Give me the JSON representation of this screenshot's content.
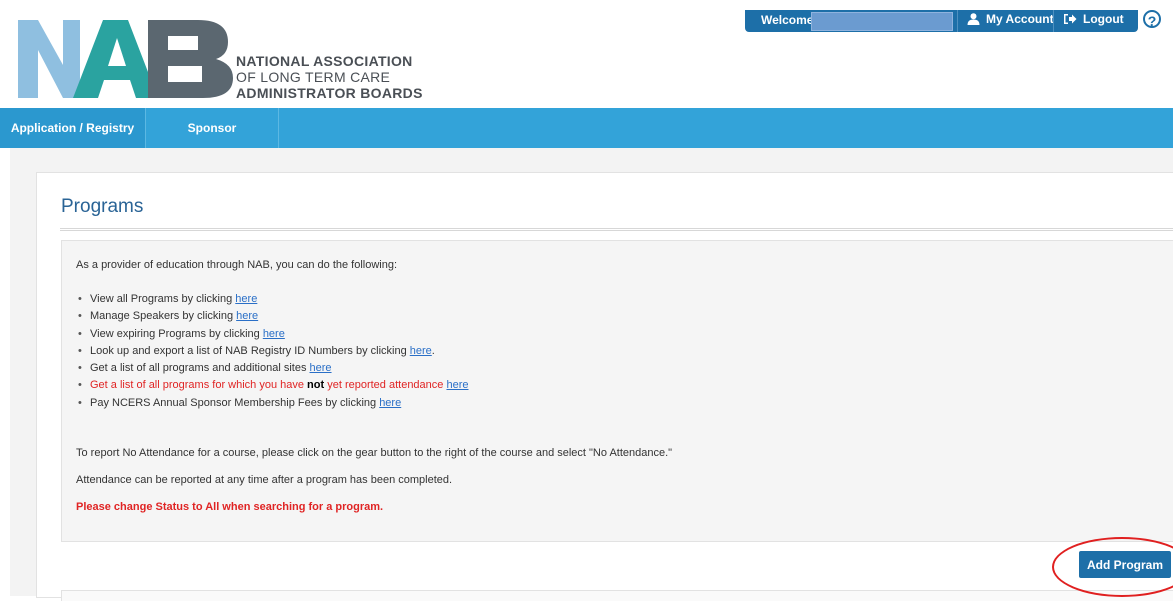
{
  "header": {
    "org_line1": "NATIONAL ASSOCIATION",
    "org_line2": "OF LONG TERM CARE",
    "org_line3": "ADMINISTRATOR BOARDS",
    "logo_letters": "NAB",
    "welcome_label": "Welcome",
    "account_label": "My Account",
    "logout_label": "Logout",
    "help_label": "?"
  },
  "nav": {
    "items": [
      {
        "label": "Application / Registry"
      },
      {
        "label": "Sponsor"
      }
    ]
  },
  "main": {
    "title": "Programs",
    "intro": "As a provider of education through NAB, you can do the following:",
    "actions": [
      {
        "text": "View all Programs by clicking ",
        "link": "here",
        "after": ""
      },
      {
        "text": "Manage Speakers by clicking ",
        "link": "here",
        "after": ""
      },
      {
        "text": "View expiring Programs by clicking ",
        "link": "here",
        "after": ""
      },
      {
        "text": "Look up and export a list of NAB Registry ID Numbers by clicking ",
        "link": "here",
        "after": "."
      },
      {
        "text": "Get a list of all programs and additional sites ",
        "link": "here",
        "after": ""
      },
      {
        "text_before": "Get a list of all programs for which you have ",
        "bold": "not",
        "text": " yet reported attendance ",
        "link": "here",
        "after": ""
      },
      {
        "text": "Pay NCERS Annual Sponsor Membership Fees by clicking ",
        "link": "here",
        "after": ""
      }
    ],
    "para1": "To report No Attendance for a course, please click on the gear button to the right of the course and select \"No Attendance.\"",
    "para2": "Attendance can be reported at any time after a program has been completed.",
    "warning": "Please change Status to All when searching for a program.",
    "add_button": "Add Program"
  },
  "colors": {
    "brand_blue": "#1d6fa8",
    "nav_blue": "#33a3d9",
    "alert_red": "#e02424",
    "link_blue": "#2a6fc7"
  }
}
